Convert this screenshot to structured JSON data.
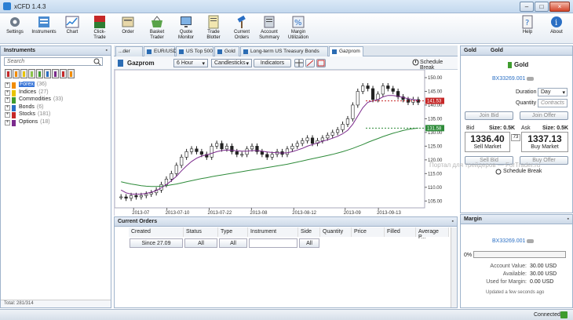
{
  "window": {
    "title": "xCFD 1.4.3",
    "min": "–",
    "max": "□",
    "close": "×"
  },
  "toolbar": {
    "items": [
      "Settings",
      "Instruments",
      "Chart",
      "Click-Trade",
      "Order",
      "Basket Trader",
      "Quote Monitor",
      "Trade Blotter",
      "Current Orders",
      "Account Summary",
      "Margin Utilization"
    ],
    "help": "Help",
    "about": "About"
  },
  "instruments": {
    "title": "Instruments",
    "search_placeholder": "Search",
    "tree": [
      {
        "name": "Forex",
        "count": "(36)",
        "color": "#f28c00"
      },
      {
        "name": "Indices",
        "count": "(27)",
        "color": "#e9c400"
      },
      {
        "name": "Commodities",
        "count": "(33)",
        "color": "#3f9c2e"
      },
      {
        "name": "Bonds",
        "count": "(6)",
        "color": "#2a6fc4"
      },
      {
        "name": "Stocks",
        "count": "(181)",
        "color": "#c62828"
      },
      {
        "name": "Options",
        "count": "(18)",
        "color": "#7b2a8c"
      }
    ],
    "swatch_colors": [
      "#c62828",
      "#f28c00",
      "#e9c400",
      "#8bc34a",
      "#3f9c2e",
      "#2a6fc4",
      "#7b2a8c",
      "#c62828",
      "#f28c00"
    ],
    "total": "Total: 281/314"
  },
  "tabs": [
    "...der",
    "EUR/USD",
    "US Top 500",
    "Gold",
    "Long-term US Treasury Bonds",
    "Gazprom"
  ],
  "chart": {
    "instrument": "Gazprom",
    "interval": "6 Hour",
    "style": "Candlesticks",
    "indicators": "Indicators",
    "schedule": "Schedule Break",
    "price_tag_red": "141.53",
    "price_tag_green": "131.58"
  },
  "chart_data": {
    "type": "line",
    "yticks": [
      "150.00",
      "145.00",
      "140.00",
      "135.00",
      "130.00",
      "125.00",
      "120.00",
      "115.00",
      "110.00",
      "105.00"
    ],
    "ylim": [
      102.5,
      152
    ],
    "xticks": [
      "2013-07",
      "2013-07-10",
      "2013-07-22",
      "2013-08",
      "2013-08-12",
      "2013-09",
      "2013-09-13"
    ],
    "candles": [
      106.5,
      106,
      107,
      106.5,
      107,
      107.5,
      108,
      109,
      111,
      113,
      115,
      118,
      121,
      123,
      124,
      123,
      122,
      121,
      125,
      126,
      124,
      125,
      123,
      122,
      122,
      124,
      125,
      123,
      122,
      121,
      122,
      123,
      122,
      124,
      125,
      126,
      127,
      128,
      126,
      127,
      128,
      129,
      130,
      131,
      133,
      135,
      140,
      145,
      147,
      146,
      142,
      144,
      147,
      146,
      145,
      143,
      142,
      141,
      142,
      141
    ],
    "ma_short": [
      109,
      108,
      107.5,
      107.5,
      107.5,
      107.8,
      108.2,
      108.8,
      109.8,
      111,
      112.4,
      114,
      116,
      117.8,
      119.4,
      120.6,
      121.4,
      121.8,
      122.4,
      123,
      123.4,
      123.6,
      123.5,
      123.3,
      123.2,
      123.2,
      123.4,
      123.4,
      123.2,
      122.9,
      122.7,
      122.6,
      122.5,
      122.6,
      123,
      123.6,
      124.2,
      125,
      125.6,
      126.2,
      126.8,
      127.3,
      127.9,
      128.6,
      129.5,
      130.8,
      133,
      136,
      139,
      141,
      141.5,
      142,
      143,
      143.5,
      143.5,
      143.2,
      142.8,
      142.3,
      142,
      141.7
    ],
    "ma_long": [
      112,
      111.6,
      111.2,
      110.9,
      110.6,
      110.4,
      110.3,
      110.3,
      110.4,
      110.6,
      110.9,
      111.2,
      111.6,
      112,
      112.4,
      112.8,
      113.2,
      113.5,
      113.9,
      114.2,
      114.5,
      114.8,
      115.1,
      115.4,
      115.7,
      116,
      116.3,
      116.6,
      116.9,
      117.2,
      117.5,
      117.8,
      118.1,
      118.4,
      118.8,
      119.2,
      119.6,
      120,
      120.4,
      120.8,
      121.2,
      121.6,
      122,
      122.5,
      123,
      123.6,
      124.2,
      124.9,
      125.6,
      126.4,
      127.1,
      127.8,
      128.5,
      129.1,
      129.7,
      130.2,
      130.7,
      131.1,
      131.4,
      131.58
    ]
  },
  "orders": {
    "title": "Current Orders",
    "columns": [
      "Created",
      "Status",
      "Type",
      "Instrument",
      "Side",
      "Quantity",
      "Price",
      "Filled",
      "Average P..."
    ],
    "filters": [
      "Since 27.09",
      "All",
      "All",
      "",
      "All"
    ]
  },
  "trade": {
    "tabs": [
      "Gold",
      "Gold"
    ],
    "instrument": "Gold",
    "account": "BX33269.001",
    "duration_label": "Duration",
    "duration_value": "Day",
    "quantity_label": "Quantity",
    "quantity_placeholder": "Contracts",
    "join_bid": "Join Bid",
    "join_offer": "Join Offer",
    "bid_label": "Bid",
    "ask_label": "Ask",
    "bid_size": "Size: 0.5K",
    "ask_size": "Size: 0.5K",
    "bid_price": "1336.40",
    "ask_price": "1337.13",
    "spread": "73",
    "sell": "Sell Market",
    "buy": "Buy Market",
    "sell_bid": "Sell Bid",
    "buy_offer": "Buy Offer",
    "schedule": "Schedule Break",
    "watermark": "Портал для трейдеров — ForTrader.ru"
  },
  "margin": {
    "title": "Margin",
    "account": "BX33269.001",
    "progress": "0%",
    "rows": [
      {
        "label": "Account Value:",
        "value": "30.00 USD"
      },
      {
        "label": "Available:",
        "value": "30.00 USD"
      },
      {
        "label": "Used for Margin:",
        "value": "0.00 USD"
      }
    ],
    "updated": "Updated a few seconds ago"
  },
  "status": "Connected"
}
